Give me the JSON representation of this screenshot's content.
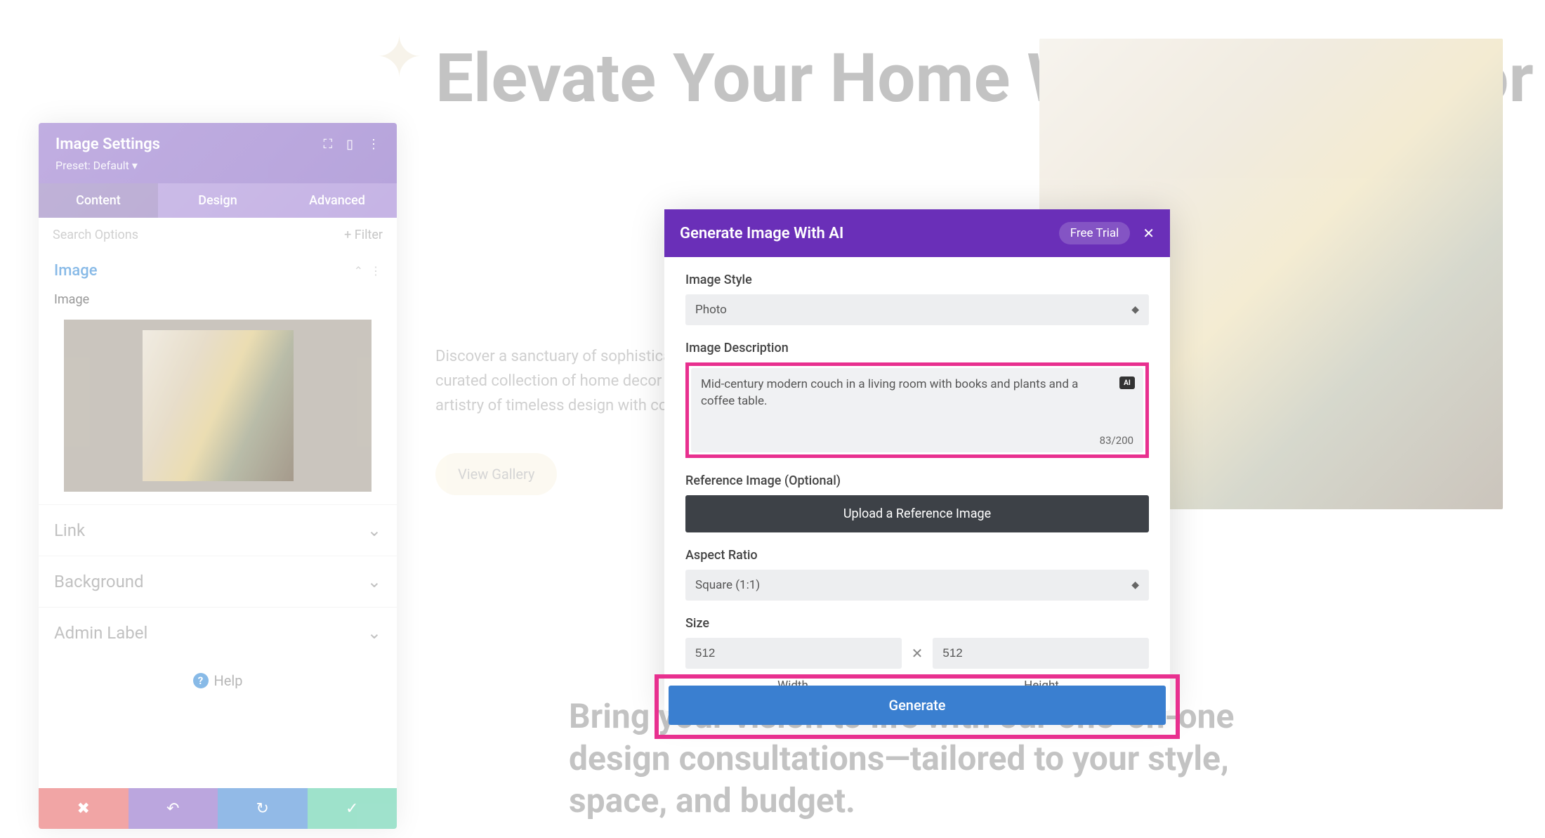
{
  "hero": {
    "title": "Elevate Your Home With Divi Interior",
    "desc": "Discover a sanctuary of sophistication and comfort. Our curated collection of home decor pieces brings together the artistry of timeless design with contemporary charm.",
    "btn": "View Gallery",
    "sub": "Bring your vision to life with our one-on-one design consultations—tailored to your style, space, and budget."
  },
  "sidebar": {
    "title": "Image Settings",
    "preset": "Preset: Default ▾",
    "tabs": {
      "content": "Content",
      "design": "Design",
      "advanced": "Advanced"
    },
    "search_placeholder": "Search Options",
    "filter": "+ Filter",
    "section_image": "Image",
    "field_image": "Image",
    "sections": {
      "link": "Link",
      "background": "Background",
      "admin_label": "Admin Label"
    },
    "help": "Help"
  },
  "modal": {
    "title": "Generate Image With AI",
    "trial": "Free Trial",
    "style_label": "Image Style",
    "style_value": "Photo",
    "desc_label": "Image Description",
    "desc_value": "Mid-century modern couch in a living room with books and plants and a coffee table.",
    "ai_badge": "AI",
    "char_count": "83/200",
    "ref_label": "Reference Image (Optional)",
    "upload": "Upload a Reference Image",
    "aspect_label": "Aspect Ratio",
    "aspect_value": "Square (1:1)",
    "size_label": "Size",
    "width": "512",
    "height": "512",
    "width_label": "Width",
    "height_label": "Height",
    "generate": "Generate"
  }
}
